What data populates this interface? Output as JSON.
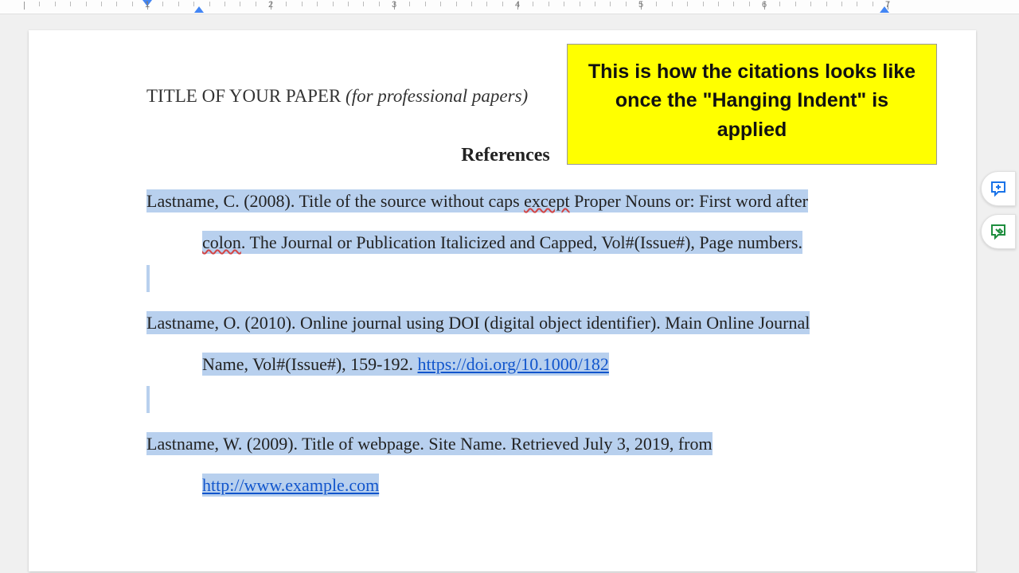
{
  "ruler": {
    "labels": [
      "1",
      "2",
      "3",
      "4",
      "5",
      "6",
      "7"
    ]
  },
  "document": {
    "title_pre": "TITLE OF YOUR PAPER ",
    "title_italic": "(for professional papers)",
    "references_heading": "References",
    "citations": [
      {
        "line1_a": "Lastname, C. (2008). Title of the source without caps ",
        "line1_spell": "except",
        "line1_b": " Proper Nouns or: First word after",
        "line2_spell": "colon",
        "line2_b": ". The Journal or Publication Italicized and Capped, Vol#(Issue#), Page numbers."
      },
      {
        "line1": "Lastname, O. (2010). Online journal using DOI (digital object identifier). Main Online Journal",
        "line2_a": "Name, Vol#(Issue#), 159-192. ",
        "line2_link": "https://doi.org/10.1000/182"
      },
      {
        "line1": "Lastname, W. (2009). Title of webpage. Site Name. Retrieved July 3, 2019, from",
        "line2_link": "http://www.example.com"
      }
    ]
  },
  "callout": {
    "text": "This is how the citations looks like once the \"Hanging Indent\" is applied"
  },
  "side": {
    "add_comment": "add-comment",
    "suggest": "suggest-edit"
  }
}
